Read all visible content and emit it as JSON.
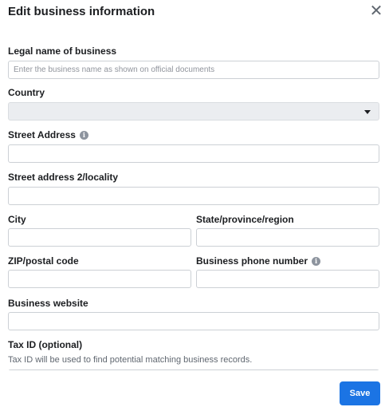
{
  "dialog": {
    "title": "Edit business information",
    "close_icon": "close-icon"
  },
  "form": {
    "legal_name": {
      "label": "Legal name of business",
      "placeholder": "Enter the business name as shown on official documents",
      "value": ""
    },
    "country": {
      "label": "Country",
      "value": ""
    },
    "street": {
      "label": "Street Address",
      "icon": "info-icon",
      "value": ""
    },
    "street2": {
      "label": "Street address 2/locality",
      "value": ""
    },
    "city": {
      "label": "City",
      "value": ""
    },
    "state": {
      "label": "State/province/region",
      "value": ""
    },
    "zip": {
      "label": "ZIP/postal code",
      "value": ""
    },
    "phone": {
      "label": "Business phone number",
      "icon": "info-icon",
      "value": ""
    },
    "website": {
      "label": "Business website",
      "value": ""
    },
    "tax": {
      "label": "Tax ID (optional)",
      "helper": "Tax ID will be used to find potential matching business records.",
      "value": ""
    }
  },
  "footer": {
    "save_label": "Save"
  },
  "colors": {
    "primary": "#1b74e4",
    "border": "#ccd0d5",
    "select_bg": "#ebedf0"
  }
}
